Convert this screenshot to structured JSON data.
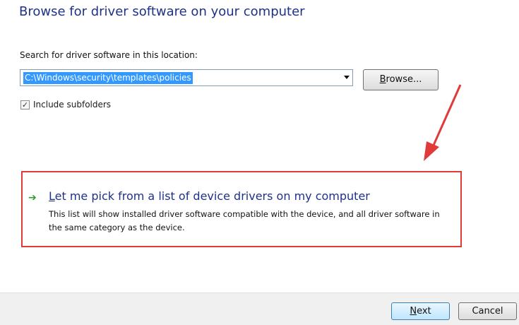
{
  "header": {
    "title": "Browse for driver software on your computer"
  },
  "search": {
    "label": "Search for driver software in this location:",
    "path_value": "C:\\Windows\\security\\templates\\policies",
    "browse_mnemonic": "B",
    "browse_rest": "rowse..."
  },
  "options": {
    "include_subfolders_label": "Include subfolders",
    "include_subfolders_checked": true
  },
  "pick_option": {
    "title_mnemonic": "L",
    "title_rest": "et me pick from a list of device drivers on my computer",
    "description": "This list will show installed driver software compatible with the device, and all driver software in the same category as the device."
  },
  "footer": {
    "next_mnemonic": "N",
    "next_rest": "ext",
    "cancel_label": "Cancel"
  },
  "colors": {
    "highlight_border": "#e03a3a",
    "title_blue": "#1e3287",
    "selection": "#3399ff"
  }
}
